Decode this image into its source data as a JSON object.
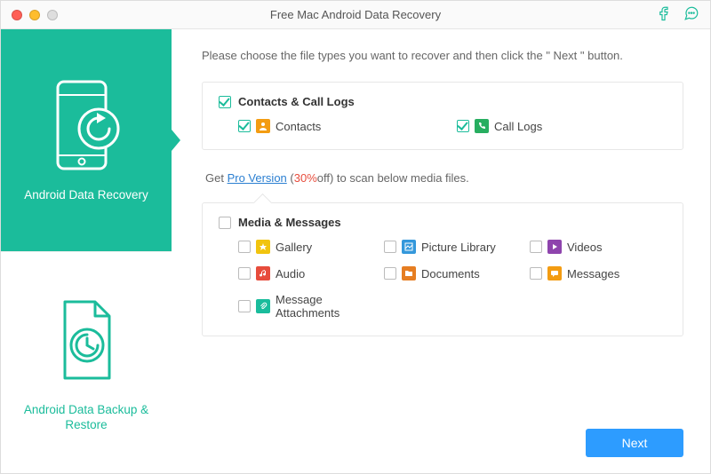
{
  "titlebar": {
    "title": "Free Mac Android Data Recovery"
  },
  "sidebar": {
    "items": [
      {
        "label": "Android Data Recovery",
        "active": true
      },
      {
        "label": "Android Data Backup & Restore",
        "active": false
      }
    ]
  },
  "main": {
    "instruction": "Please choose the file types you want to recover and then click the \" Next \" button.",
    "groups": {
      "contacts": {
        "title": "Contacts & Call Logs",
        "checked": true,
        "items": {
          "contacts": {
            "label": "Contacts",
            "checked": true,
            "color": "c-orange"
          },
          "call_logs": {
            "label": "Call Logs",
            "checked": true,
            "color": "c-green"
          }
        }
      },
      "media": {
        "title": "Media & Messages",
        "checked": false,
        "items": {
          "gallery": {
            "label": "Gallery",
            "checked": false,
            "color": "c-yellow"
          },
          "picture_library": {
            "label": "Picture Library",
            "checked": false,
            "color": "c-blue"
          },
          "videos": {
            "label": "Videos",
            "checked": false,
            "color": "c-purple"
          },
          "audio": {
            "label": "Audio",
            "checked": false,
            "color": "c-red"
          },
          "documents": {
            "label": "Documents",
            "checked": false,
            "color": "c-orange2"
          },
          "messages": {
            "label": "Messages",
            "checked": false,
            "color": "c-orange"
          },
          "attachments": {
            "label": "Message Attachments",
            "checked": false,
            "color": "c-green2"
          }
        }
      }
    },
    "pro": {
      "prefix": "Get ",
      "link": "Pro Version",
      "open_paren": " (",
      "discount": "30%",
      "close_paren": "off) to scan below media files."
    }
  },
  "footer": {
    "next": "Next"
  }
}
